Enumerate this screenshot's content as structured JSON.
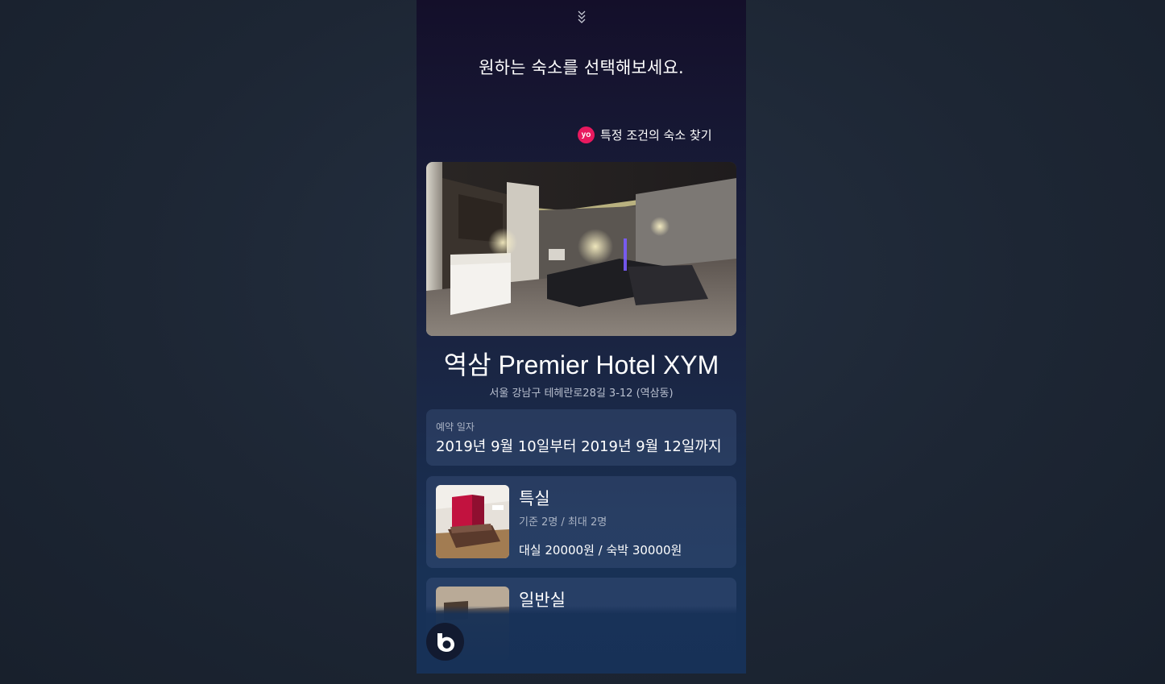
{
  "header": {
    "collapse_icon": "double-chevron-down-icon",
    "prompt": "원하는 숙소를 선택해보세요."
  },
  "filter_link": {
    "logo_text": "yo",
    "label": "특정 조건의 숙소 찾기"
  },
  "hotel": {
    "name": "역삼 Premier Hotel XYM",
    "address": "서울 강남구 테헤란로28길 3-12 (역삼동)"
  },
  "reservation": {
    "label": "예약 일자",
    "value": "2019년 9월 10일부터 2019년 9월 12일까지"
  },
  "rooms": [
    {
      "name": "특실",
      "capacity": "기준 2명 / 최대 2명",
      "price": "대실 20000원 / 숙박 30000원"
    },
    {
      "name": "일반실"
    }
  ],
  "assistant": {
    "icon": "bixby-icon"
  },
  "colors": {
    "brand_pink": "#e8195f",
    "panel_top": "#140f2a",
    "panel_bottom": "#173157"
  }
}
